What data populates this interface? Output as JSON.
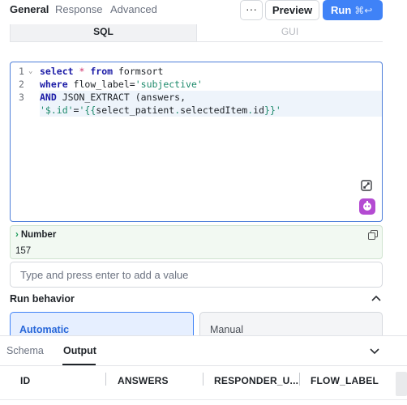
{
  "tabs": [
    {
      "label": "General",
      "active": true
    },
    {
      "label": "Response",
      "active": false
    },
    {
      "label": "Advanced",
      "active": false
    }
  ],
  "toolbar": {
    "more_label": "···",
    "preview_label": "Preview",
    "run_label": "Run",
    "run_shortcut": "⌘↩",
    "run_color": "#3f82f7"
  },
  "mode_switch": {
    "sql_label": "SQL",
    "gui_label": "GUI",
    "selected": "SQL"
  },
  "editor": {
    "line_numbers": [
      "1",
      "2",
      "3",
      ""
    ],
    "lines": [
      [
        {
          "t": "select",
          "c": "kw"
        },
        {
          "t": " ",
          "c": ""
        },
        {
          "t": "*",
          "c": "op"
        },
        {
          "t": " ",
          "c": ""
        },
        {
          "t": "from",
          "c": "kw"
        },
        {
          "t": " formsort",
          "c": ""
        }
      ],
      [
        {
          "t": "where",
          "c": "kw"
        },
        {
          "t": " flow_label=",
          "c": ""
        },
        {
          "t": "'subjective'",
          "c": "str"
        }
      ],
      [
        {
          "t": "AND",
          "c": "kw"
        },
        {
          "t": " JSON_EXTRACT (answers,",
          "c": ""
        }
      ],
      [
        {
          "t": "'$.id'",
          "c": "str"
        },
        {
          "t": "=",
          "c": ""
        },
        {
          "t": "'{{",
          "c": "tpl"
        },
        {
          "t": "select_patient",
          "c": ""
        },
        {
          "t": ".",
          "c": "tpl"
        },
        {
          "t": "selectedItem",
          "c": ""
        },
        {
          "t": ".",
          "c": "tpl"
        },
        {
          "t": "id",
          "c": ""
        },
        {
          "t": "}}'",
          "c": "tpl"
        }
      ]
    ],
    "icons": [
      "expand-editor-icon",
      "ai-assistant-icon"
    ]
  },
  "result": {
    "type_label": "Number",
    "value": "157"
  },
  "value_input": {
    "placeholder": "Type and press enter to add a value"
  },
  "run_behavior": {
    "label": "Run behavior",
    "options": [
      "Automatic",
      "Manual"
    ],
    "selected": "Automatic"
  },
  "bottom_panel": {
    "tabs": [
      {
        "label": "Schema",
        "active": false
      },
      {
        "label": "Output",
        "active": true
      }
    ],
    "columns": [
      "ID",
      "ANSWERS",
      "RESPONDER_U...",
      "FLOW_LABEL"
    ]
  }
}
